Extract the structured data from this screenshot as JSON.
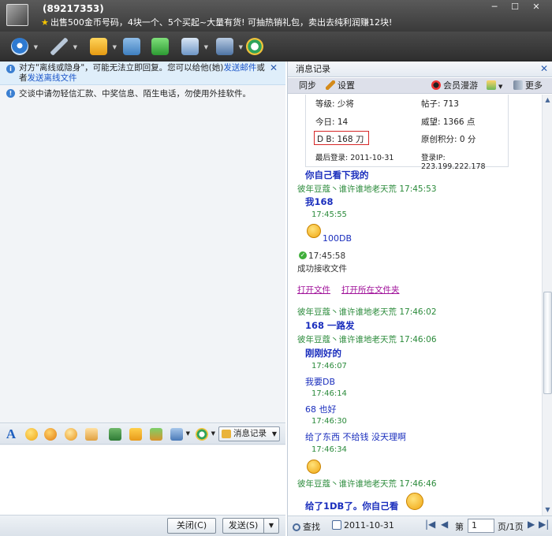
{
  "window": {
    "qq_number": "(89217353)",
    "signature": "出售500金币号码，4块一个、5个买起~大量有货! 可抽热销礼包，卖出去纯利润赚12块!"
  },
  "left": {
    "notice1": {
      "pre": "对方\"离线或隐身\"，可能无法立即回复。您可以给他(她)",
      "link1": "发送邮件",
      "mid": "或者",
      "link2": "发送离线文件"
    },
    "notice2": "交谈中请勿轻信汇款、中奖信息、陌生电话，勿使用外挂软件。",
    "msg_record_label": "消息记录",
    "close_label": "关闭(C)",
    "send_label": "发送(S)"
  },
  "right": {
    "header_title": "消息记录",
    "sync_label": "同步",
    "settings_label": "设置",
    "vip_label": "会员漫游",
    "more_label": "更多",
    "profile": {
      "level": "等级: 少将",
      "posts": "帖子: 713",
      "today": "今日: 14",
      "prestige": "威望: 1366 点",
      "db": "D B: 168 刀",
      "original": "原创积分: 0 分",
      "last_login": "最后登录: 2011-10-31",
      "login_ip": "登录IP: 223.199.222.178"
    },
    "messages": {
      "m1": "你自己看下我的",
      "sender": "彼年豆蔻丶谁许谁地老天荒",
      "t1": "17:45:53",
      "m2": "我168",
      "t2": "17:45:55",
      "m3": "100DB",
      "t3": "17:45:58",
      "recv": "成功接收文件",
      "open_file": "打开文件",
      "open_folder": "打开所在文件夹",
      "t4": "17:46:02",
      "m4": "168  一路发",
      "t5": "17:46:06",
      "m5": "刚刚好的",
      "t6": "17:46:07",
      "m6": "我要DB",
      "t7": "17:46:14",
      "m7": "68  也好",
      "t8": "17:46:30",
      "m8": "给了东西  不给钱    没天理啊",
      "t9": "17:46:34",
      "t10": "17:46:46",
      "m9": "给了1DB了。你自己看"
    },
    "bottom": {
      "find_label": "查找",
      "date": "2011-10-31",
      "page_prefix": "第",
      "page_value": "1",
      "page_suffix": "页/1页"
    }
  },
  "colors": {
    "sender_green": "#2a8a3a",
    "message_blue": "#1a2ebd",
    "link_purple": "#a0129a",
    "titlebar": "#3a3a3a"
  }
}
